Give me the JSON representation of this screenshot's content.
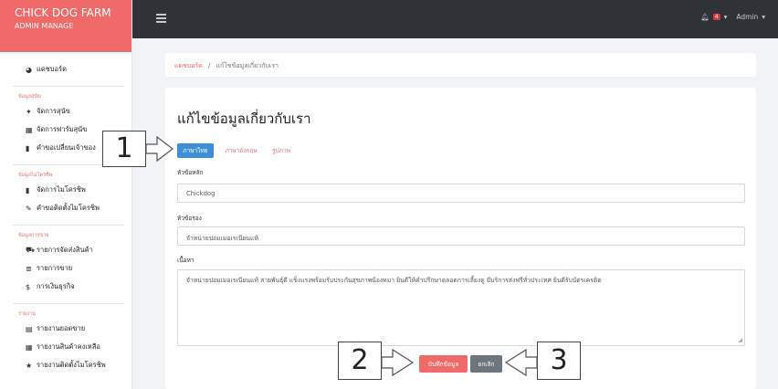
{
  "brand": {
    "title": "CHICK DOG FARM",
    "subtitle": "ADMIN MANAGE"
  },
  "topbar": {
    "notification_count": "4",
    "admin_label": "Admin"
  },
  "sidebar": {
    "dashboard": "แดชบอร์ด",
    "sections": [
      {
        "heading": "ข้อมูลสุนัข",
        "items": [
          "จัดการสุนัข",
          "จัดการฟาร์มสุนัข",
          "คำขอเปลี่ยนเจ้าของ"
        ]
      },
      {
        "heading": "ข้อมูลไมโครชิพ",
        "items": [
          "จัดการไมโครชิพ",
          "คำขอติดตั้งไมโครชิพ"
        ]
      },
      {
        "heading": "ข้อมูลการขาย",
        "items": [
          "รายการจัดส่งสินค้า",
          "รายการขาย",
          "การเงินธุรกิจ"
        ]
      },
      {
        "heading": "รายงาน",
        "items": [
          "รายงานยอดขาย",
          "รายงานสินค้าคงเหลือ",
          "รายงานติดตั้งไมโครชิพ"
        ]
      }
    ]
  },
  "breadcrumb": {
    "home": "แดชบอร์ด",
    "separator": "/",
    "current": "แก้ไขข้อมูลเกี่ยวกับเรา"
  },
  "page": {
    "title": "แก้ไขข้อมูลเกี่ยวกับเรา",
    "tabs": [
      "ภาษาไทย",
      "ภาษาอังกฤษ",
      "รูปภาพ"
    ],
    "fields": {
      "main_title_label": "หัวข้อหลัก",
      "main_title_value": "Chickdog",
      "sub_title_label": "หัวข้อรอง",
      "sub_title_value": "จำหน่ายปอมเมอเรเนียนแท้",
      "content_label": "เนื้อหา",
      "content_value": "จำหน่ายปอมเมอเรเนียนแท้ สายพันธุ์ดี แข็งแรงพร้อมรับประกันสุขภาพน้องหมา ยินดีให้คำปรึกษาตลอดการเลี้ยงดู มีบริการส่งฟรีทั่วประเทศ ยินดีรับบัตรเครดิต"
    },
    "buttons": {
      "save": "บันทึกข้อมูล",
      "cancel": "ยกเลิก"
    }
  },
  "annotations": {
    "callout_1": "1",
    "callout_2": "2",
    "callout_3": "3"
  },
  "colors": {
    "brand": "#f06a6a",
    "topbar": "#2f3337",
    "primary_tab": "#3d8fd8",
    "cancel": "#6d757d"
  }
}
